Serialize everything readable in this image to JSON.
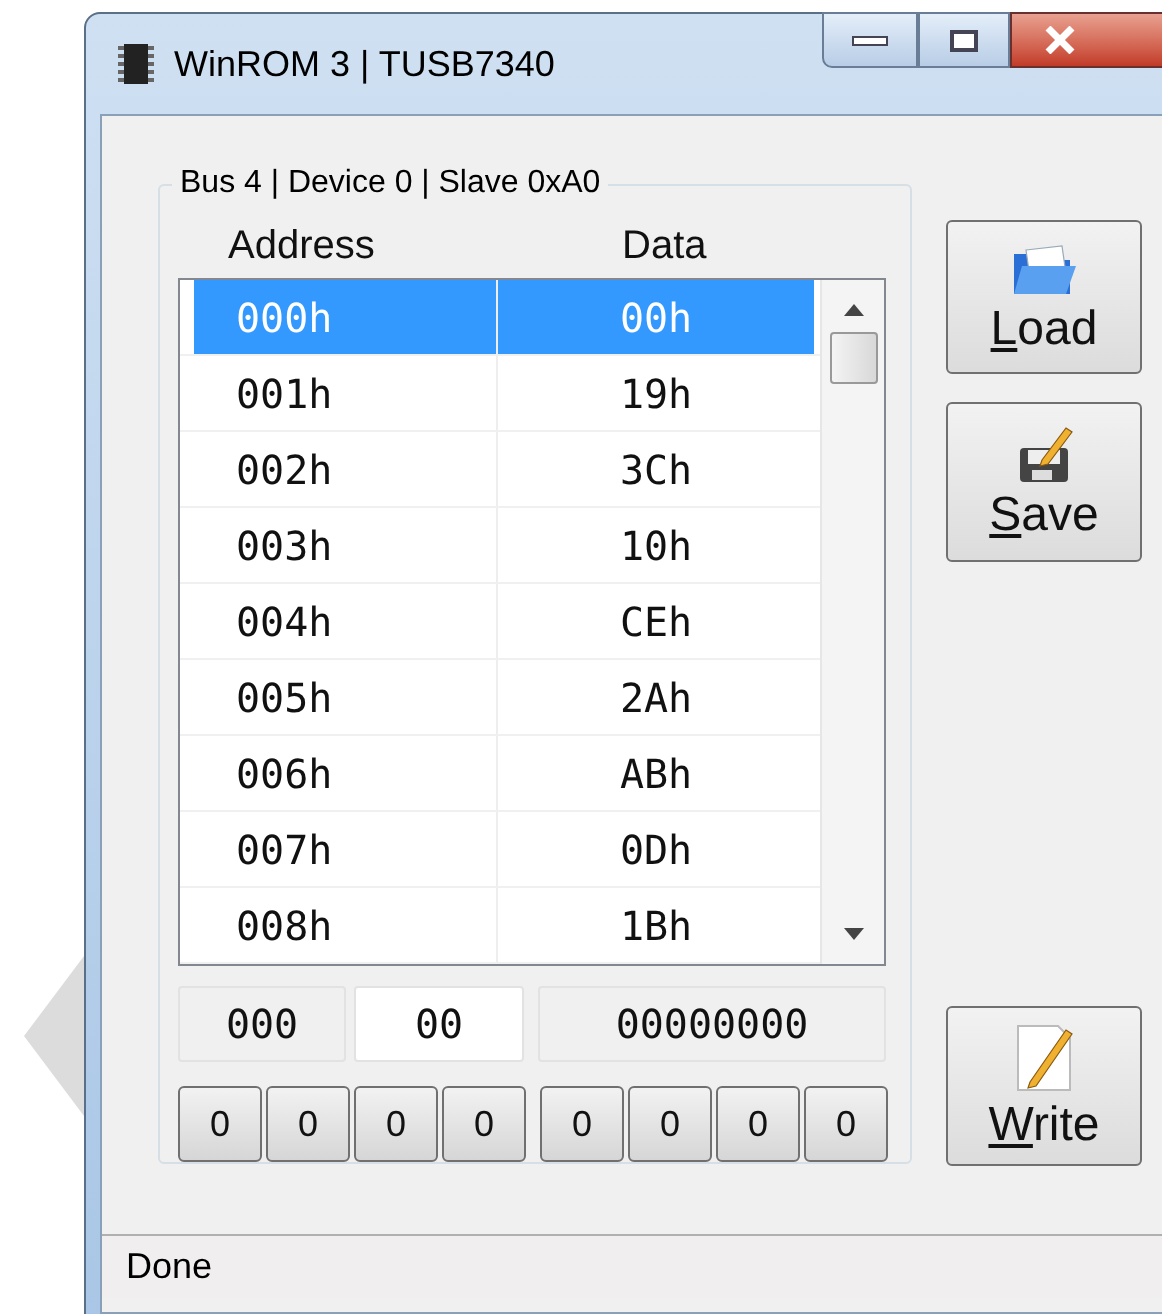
{
  "window": {
    "title": "WinROM 3 | TUSB7340"
  },
  "group": {
    "title": "Bus 4 | Device 0 | Slave 0xA0"
  },
  "table": {
    "columns": [
      "Address",
      "Data"
    ],
    "rows": [
      {
        "address": "000h",
        "data": "00h",
        "selected": true
      },
      {
        "address": "001h",
        "data": "19h",
        "selected": false
      },
      {
        "address": "002h",
        "data": "3Ch",
        "selected": false
      },
      {
        "address": "003h",
        "data": "10h",
        "selected": false
      },
      {
        "address": "004h",
        "data": "CEh",
        "selected": false
      },
      {
        "address": "005h",
        "data": "2Ah",
        "selected": false
      },
      {
        "address": "006h",
        "data": "ABh",
        "selected": false
      },
      {
        "address": "007h",
        "data": "0Dh",
        "selected": false
      },
      {
        "address": "008h",
        "data": "1Bh",
        "selected": false
      }
    ]
  },
  "fields": {
    "address": "000",
    "data": "00",
    "binary": "00000000"
  },
  "bits": [
    [
      "0",
      "0",
      "0",
      "0"
    ],
    [
      "0",
      "0",
      "0",
      "0"
    ]
  ],
  "buttons": [
    {
      "kind": "load",
      "accel": "L",
      "rest": "oad"
    },
    {
      "kind": "save",
      "accel": "S",
      "rest": "ave"
    },
    {
      "kind": "write",
      "accel": "W",
      "rest": "rite"
    }
  ],
  "status_bar": "Done"
}
